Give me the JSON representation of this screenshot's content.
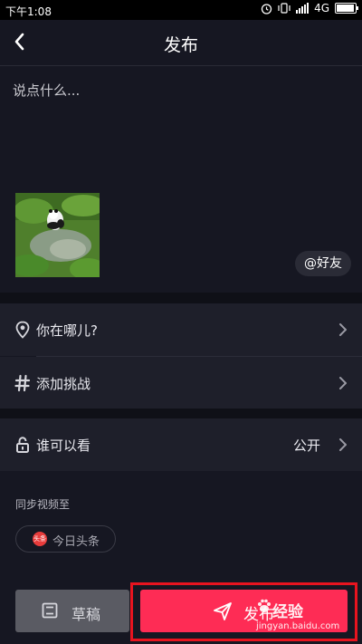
{
  "status": {
    "time": "下午1:08",
    "network": "4G"
  },
  "header": {
    "title": "发布"
  },
  "composer": {
    "placeholder": "说点什么...",
    "mention_label": "@好友"
  },
  "rows": {
    "location": {
      "label": "你在哪儿?"
    },
    "challenge": {
      "label": "添加挑战"
    },
    "privacy": {
      "label": "谁可以看",
      "value": "公开"
    }
  },
  "sync": {
    "title": "同步视频至",
    "toutiao_label": "今日头条",
    "toutiao_logo_text": "头条"
  },
  "footer": {
    "draft_label": "草稿",
    "publish_label": "发布"
  },
  "watermark": {
    "text": "经验",
    "url": "jingyan.baidu.com"
  },
  "colors": {
    "accent": "#fe2c55",
    "highlight_border": "#e8141f",
    "background": "#161722",
    "row_bg": "#1e1f2a"
  },
  "icons": [
    "back-icon",
    "alarm-icon",
    "vibrate-icon",
    "signal-icon",
    "battery-icon",
    "location-pin-icon",
    "hash-icon",
    "lock-icon",
    "chevron-right-icon",
    "draft-icon",
    "paper-plane-icon",
    "baidu-paw-icon"
  ]
}
